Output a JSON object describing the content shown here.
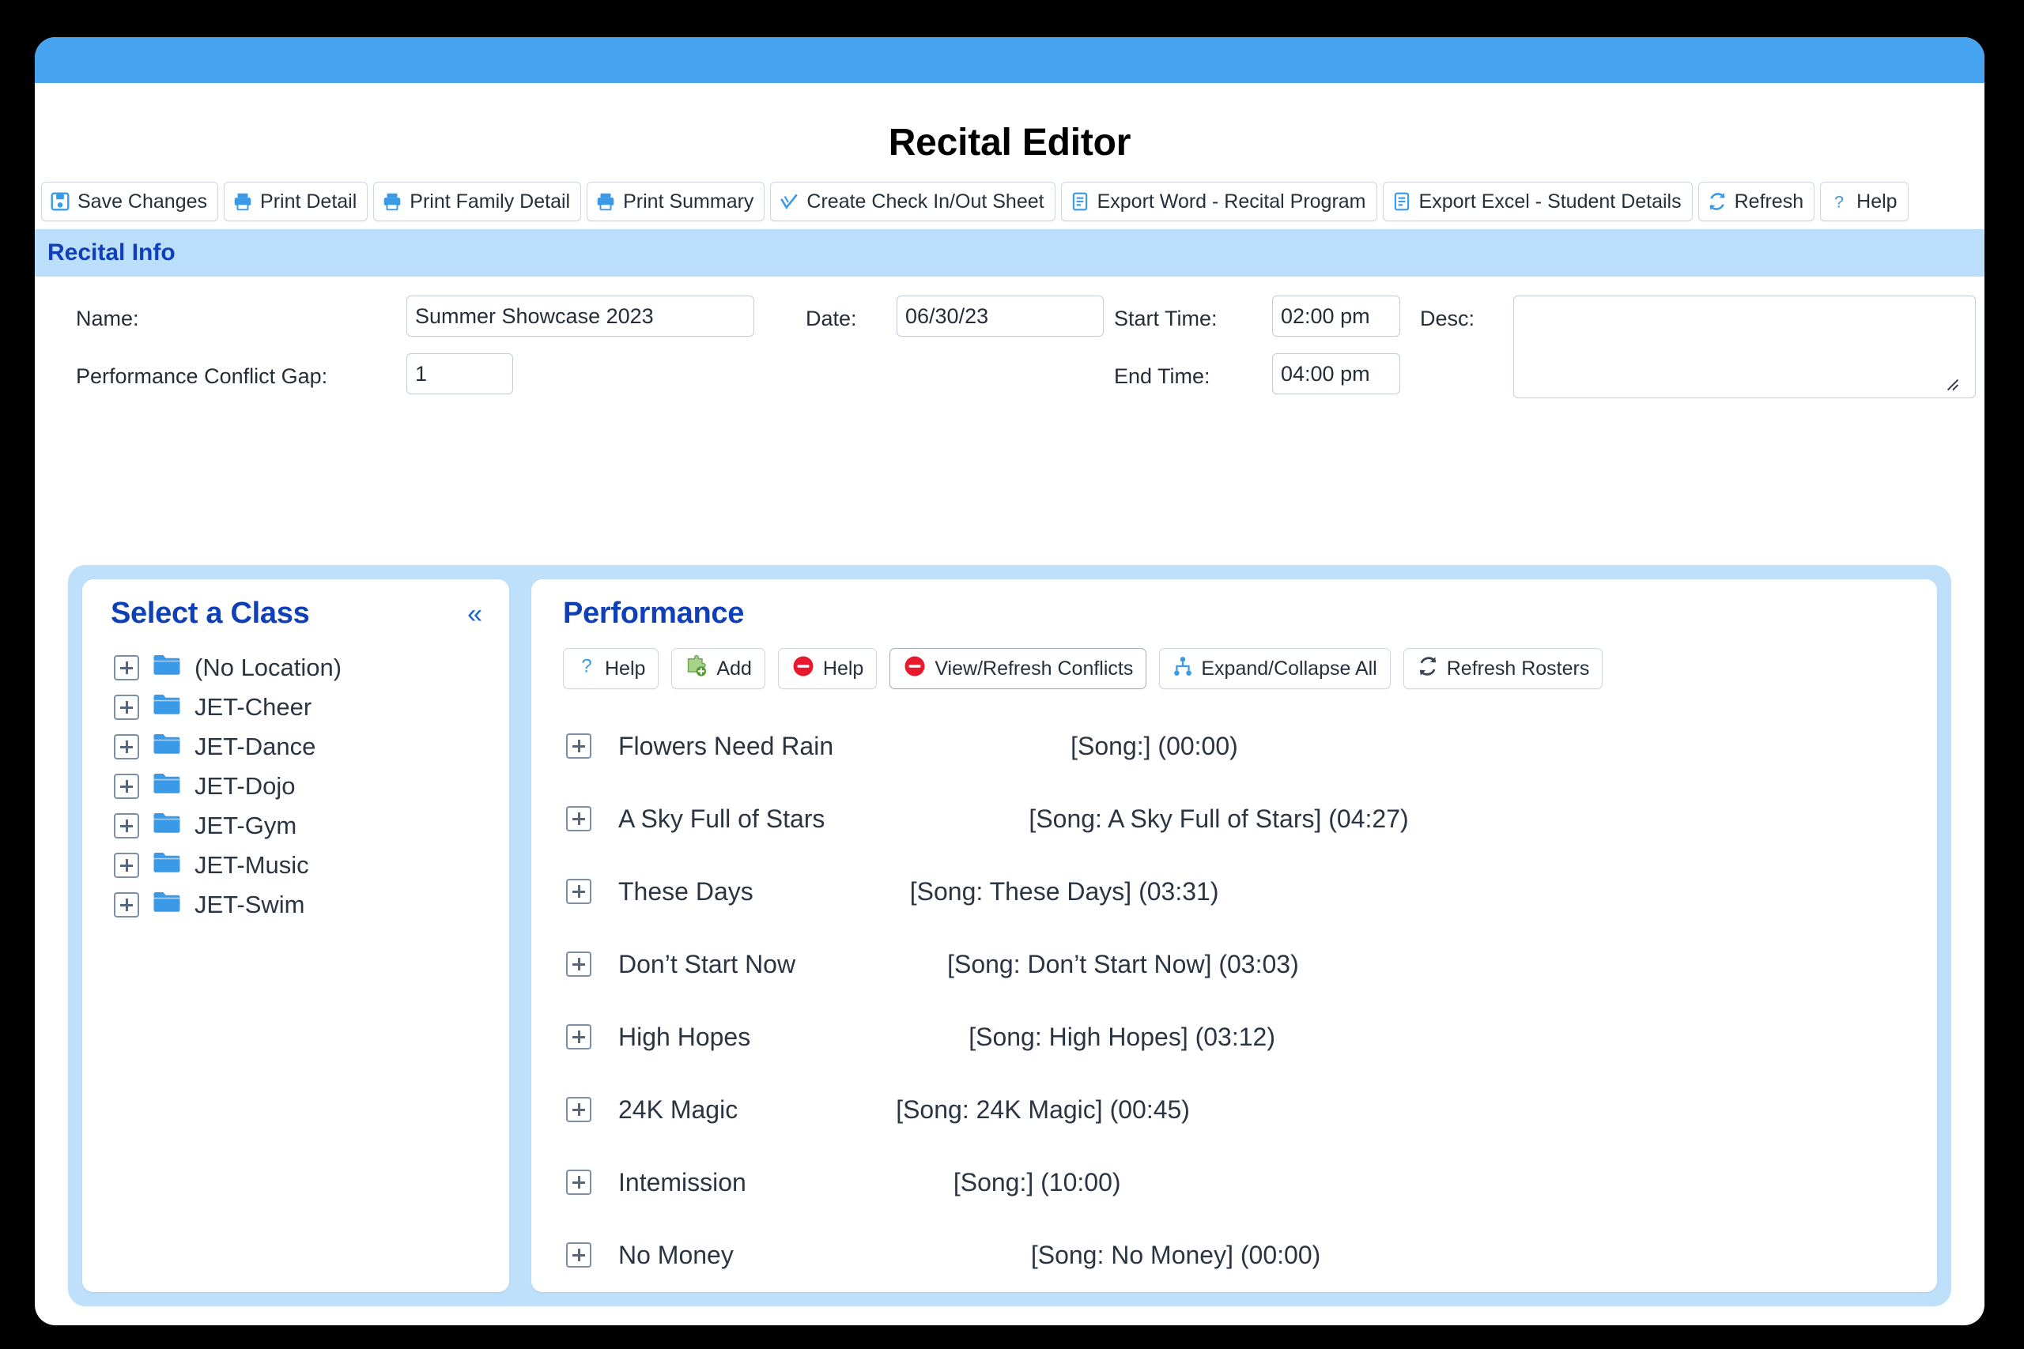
{
  "page_title": "Recital Editor",
  "toolbar": {
    "buttons": [
      {
        "label": "Save Changes",
        "icon": "save-floppy-icon"
      },
      {
        "label": "Print Detail",
        "icon": "printer-icon"
      },
      {
        "label": "Print Family Detail",
        "icon": "printer-icon"
      },
      {
        "label": "Print Summary",
        "icon": "printer-icon"
      },
      {
        "label": "Create Check In/Out Sheet",
        "icon": "checkmark-icon"
      },
      {
        "label": "Export Word - Recital Program",
        "icon": "document-icon"
      },
      {
        "label": "Export Excel - Student Details",
        "icon": "document-icon"
      },
      {
        "label": "Refresh",
        "icon": "refresh-icon"
      },
      {
        "label": "Help",
        "icon": "question-mark-icon"
      }
    ]
  },
  "recital_info": {
    "band_title": "Recital Info",
    "name_label": "Name:",
    "name_value": "Summer Showcase 2023",
    "gap_label": "Performance Conflict Gap:",
    "gap_value": "1",
    "date_label": "Date:",
    "date_value": "06/30/23",
    "start_time_label": "Start Time:",
    "start_time_value": "02:00 pm",
    "end_time_label": "End Time:",
    "end_time_value": "04:00 pm",
    "desc_label": "Desc:",
    "desc_value": ""
  },
  "classes_panel": {
    "title": "Select a Class",
    "collapse_icon": "«",
    "items": [
      {
        "label": "(No Location)"
      },
      {
        "label": "JET-Cheer"
      },
      {
        "label": "JET-Dance"
      },
      {
        "label": "JET-Dojo"
      },
      {
        "label": "JET-Gym"
      },
      {
        "label": "JET-Music"
      },
      {
        "label": "JET-Swim"
      }
    ]
  },
  "performance_panel": {
    "title": "Performance",
    "buttons": [
      {
        "label": "Help",
        "icon": "question-mark-icon"
      },
      {
        "label": "Add",
        "icon": "add-puzzle-icon"
      },
      {
        "label": "Help",
        "icon": "minus-circle-icon"
      },
      {
        "label": "View/Refresh Conflicts",
        "icon": "minus-circle-icon"
      },
      {
        "label": "Expand/Collapse All",
        "icon": "hierarchy-icon"
      },
      {
        "label": "Refresh Rosters",
        "icon": "refresh-icon"
      }
    ],
    "rows": [
      {
        "name": "Flowers Need Rain",
        "song": "[Song:] (00:00)",
        "indent": 300
      },
      {
        "name": "A Sky Full of Stars",
        "song": "[Song: A Sky Full of Stars] (04:27)",
        "indent": 258
      },
      {
        "name": "These Days",
        "song": "[Song: These Days] (03:31)",
        "indent": 198
      },
      {
        "name": " Don’t Start Now",
        "song": "[Song: Don’t Start Now] (03:03)",
        "indent": 192
      },
      {
        "name": "High Hopes",
        "song": "[Song: High Hopes] (03:12)",
        "indent": 276
      },
      {
        "name": "24K Magic",
        "song": "[Song: 24K Magic] (00:45)",
        "indent": 200
      },
      {
        "name": "Intemission",
        "song": "[Song:] (10:00)",
        "indent": 262
      },
      {
        "name": "No Money",
        "song": "[Song: No Money] (00:00)",
        "indent": 376
      }
    ]
  },
  "colors": {
    "title_bar": "#45a3ef",
    "band": "#bbdefb",
    "workspace": "#bfe0fb",
    "heading_blue": "#1040b8",
    "icon_blue": "#3a9ae8",
    "icon_red": "#e8192c",
    "icon_green": "#5fa832"
  }
}
